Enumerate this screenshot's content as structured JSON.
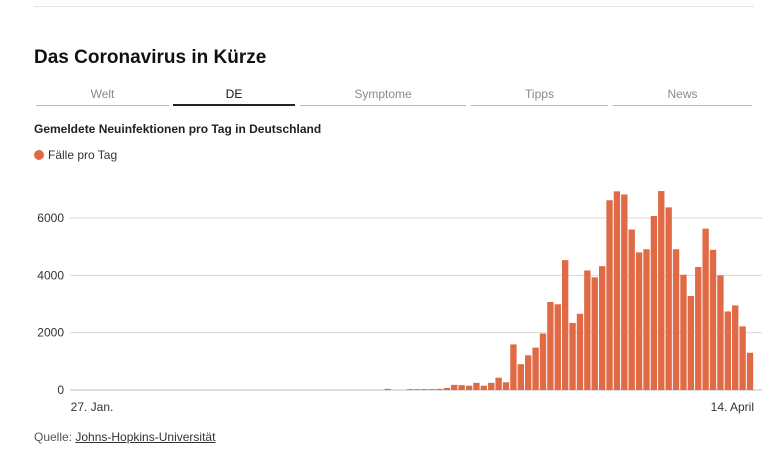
{
  "header": {
    "title": "Das Coronavirus in Kürze"
  },
  "tabs": [
    {
      "label": "Welt",
      "active": false
    },
    {
      "label": "DE",
      "active": true
    },
    {
      "label": "Symptome",
      "active": false
    },
    {
      "label": "Tipps",
      "active": false
    },
    {
      "label": "News",
      "active": false
    }
  ],
  "chart_title": "Gemeldete Neuinfektionen pro Tag in Deutschland",
  "colors": {
    "bar": "#e06a45",
    "grid": "#d9d9d9",
    "tab_active": "#222222"
  },
  "chart_data": {
    "type": "bar",
    "title": "Gemeldete Neuinfektionen pro Tag in Deutschland",
    "series": [
      {
        "name": "Fälle pro Tag",
        "values": [
          0,
          0,
          0,
          0,
          0,
          0,
          0,
          0,
          0,
          0,
          0,
          0,
          0,
          0,
          0,
          0,
          0,
          0,
          0,
          0,
          0,
          0,
          0,
          0,
          0,
          0,
          0,
          0,
          0,
          0,
          0,
          0,
          0,
          0,
          0,
          0,
          0,
          0,
          0,
          0,
          40,
          0,
          0,
          30,
          30,
          30,
          30,
          40,
          70,
          180,
          170,
          150,
          250,
          150,
          250,
          430,
          270,
          1590,
          900,
          1210,
          1480,
          1970,
          3070,
          2990,
          4530,
          2340,
          2660,
          4170,
          3930,
          4320,
          6620,
          6930,
          6820,
          5600,
          4800,
          4910,
          6070,
          6940,
          6370,
          4910,
          4020,
          3280,
          4290,
          5630,
          4890,
          4000,
          2740,
          2950,
          2220,
          1300
        ]
      }
    ],
    "x_tick_labels": [
      "27. Jan.",
      "14. April"
    ],
    "y_ticks": [
      0,
      2000,
      4000,
      6000
    ],
    "ylim": [
      0,
      7000
    ],
    "grid": true,
    "legend_position": "top-left"
  },
  "source": {
    "prefix": "Quelle: ",
    "link_label": "Johns-Hopkins-Universität"
  }
}
